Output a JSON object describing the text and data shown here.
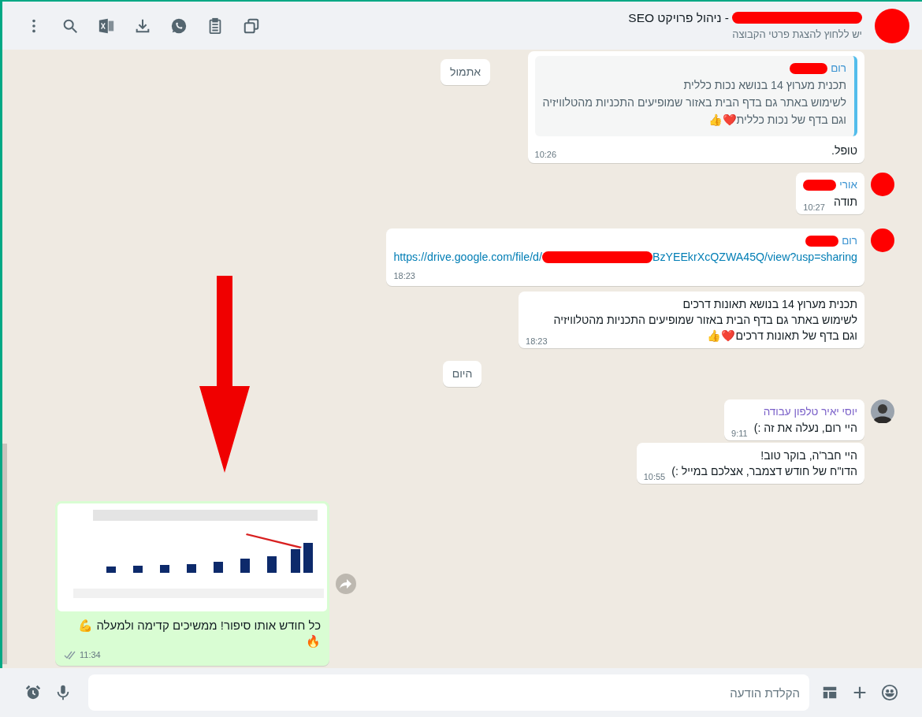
{
  "header": {
    "title": "- ניהול פרויקט SEO",
    "title_redacted": true,
    "subtitle": "יש ללחוץ להצגת פרטי הקבוצה",
    "avatar": {
      "kind": "redacted"
    }
  },
  "sticky_date": "אתמול",
  "messages": [
    {
      "kind": "incoming",
      "quote": {
        "sender": "רום",
        "sender_redacted": true,
        "color": "#3b93d1",
        "text": "תכנית מערוץ 14 בנושא נכות כללית\nלשימוש באתר גם בדף הבית באזור שמופיעים התכניות מהטלוויזיה\nוגם בדף של נכות כללית❤️👍"
      },
      "text": "טופל.",
      "time": "10:26"
    },
    {
      "kind": "incoming",
      "avatar": {
        "kind": "redacted"
      },
      "sender": {
        "name": "אורי",
        "redacted": true,
        "color": "#3b93d1"
      },
      "text": "תודה",
      "time": "10:27"
    },
    {
      "kind": "incoming",
      "avatar": {
        "kind": "redacted"
      },
      "sender": {
        "name": "רום",
        "redacted": true,
        "color": "#3b93d1"
      },
      "link": {
        "before": "https://drive.google.com/file/d/",
        "redacted": true,
        "after": "BzYEEkrXcQZWA45Q/view?usp=sharing"
      },
      "time": "18:23"
    },
    {
      "kind": "incoming",
      "text": "תכנית מערוץ 14 בנושא תאונות דרכים\nלשימוש באתר גם בדף הבית באזור שמופיעים התכניות מהטלוויזיה\nוגם בדף של תאונות דרכים❤️👍",
      "time": "18:23"
    },
    {
      "kind": "date",
      "label": "היום"
    },
    {
      "kind": "incoming",
      "sender": {
        "name": "יוסי יאיר טלפון עבודה",
        "redacted": false,
        "color": "#7b61c9"
      },
      "text": "היי רום, נעלה את זה :)",
      "time": "9:11"
    },
    {
      "kind": "incoming",
      "text": "היי חבר'ה, בוקר טוב!\nהדו\"ח של חודש דצמבר, אצלכם במייל :)",
      "time": "10:55"
    },
    {
      "caption": "כל חודש אותו סיפור! ממשיכים קדימה ולמעלה 💪\n🔥",
      "time": "11:34",
      "read": false,
      "forward": true
    }
  ],
  "composer": {
    "placeholder": "הקלדת הודעה"
  }
}
